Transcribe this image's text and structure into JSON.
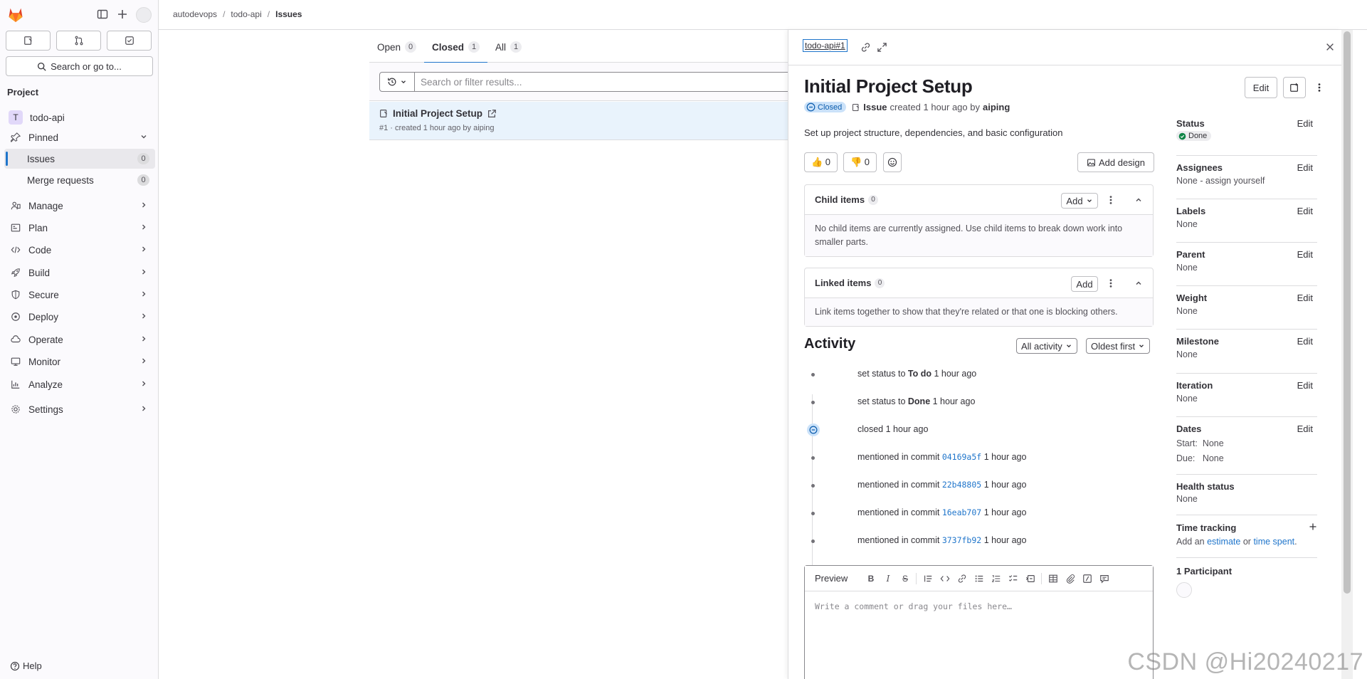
{
  "sidebar": {
    "search_label": "Search or go to...",
    "section_title": "Project",
    "project_name": "todo-api",
    "project_initial": "T",
    "pinned_label": "Pinned",
    "pinned_items": [
      {
        "label": "Issues",
        "count": "0"
      },
      {
        "label": "Merge requests",
        "count": "0"
      }
    ],
    "nav_items": [
      "Manage",
      "Plan",
      "Code",
      "Build",
      "Secure",
      "Deploy",
      "Operate",
      "Monitor",
      "Analyze",
      "Settings"
    ],
    "help_label": "Help"
  },
  "breadcrumbs": [
    "autodevops",
    "todo-api",
    "Issues"
  ],
  "tabs": [
    {
      "label": "Open",
      "count": "0"
    },
    {
      "label": "Closed",
      "count": "1"
    },
    {
      "label": "All",
      "count": "1"
    }
  ],
  "filter": {
    "placeholder": "Search or filter results..."
  },
  "issue_list": [
    {
      "title": "Initial Project Setup",
      "meta": "#1 · created 1 hour ago by aiping"
    }
  ],
  "drawer": {
    "reference": "todo-api#1",
    "title": "Initial Project Setup",
    "edit_label": "Edit",
    "state_badge": "Closed",
    "type_label": "Issue",
    "created_text": "created 1 hour ago by",
    "author": "aiping",
    "description": "Set up project structure, dependencies, and basic configuration",
    "thumbs_up": "👍 0",
    "thumbs_down": "👎 0",
    "add_design_label": "Add design",
    "child_items": {
      "title": "Child items",
      "count": "0",
      "add_label": "Add",
      "empty_text": "No child items are currently assigned. Use child items to break down work into smaller parts."
    },
    "linked_items": {
      "title": "Linked items",
      "count": "0",
      "add_label": "Add",
      "empty_text": "Link items together to show that they're related or that one is blocking others."
    },
    "activity": {
      "title": "Activity",
      "filter_label": "All activity",
      "sort_label": "Oldest first",
      "items": [
        {
          "prefix": "set status to",
          "bold": "To do",
          "suffix": "1 hour ago"
        },
        {
          "prefix": "set status to",
          "bold": "Done",
          "suffix": "1 hour ago"
        },
        {
          "prefix": "closed",
          "bold": "",
          "suffix": "1 hour ago"
        },
        {
          "prefix": "mentioned in commit",
          "commit": "04169a5f",
          "suffix": "1 hour ago"
        },
        {
          "prefix": "mentioned in commit",
          "commit": "22b48805",
          "suffix": "1 hour ago"
        },
        {
          "prefix": "mentioned in commit",
          "commit": "16eab707",
          "suffix": "1 hour ago"
        },
        {
          "prefix": "mentioned in commit",
          "commit": "3737fb92",
          "suffix": "1 hour ago"
        }
      ]
    },
    "editor": {
      "preview_label": "Preview",
      "placeholder": "Write a comment or drag your files here…"
    }
  },
  "widgets": {
    "edit_label": "Edit",
    "status": {
      "label": "Status",
      "value": "Done"
    },
    "assignees": {
      "label": "Assignees",
      "value": "None - assign yourself"
    },
    "labels": {
      "label": "Labels",
      "value": "None"
    },
    "parent": {
      "label": "Parent",
      "value": "None"
    },
    "weight": {
      "label": "Weight",
      "value": "None"
    },
    "milestone": {
      "label": "Milestone",
      "value": "None"
    },
    "iteration": {
      "label": "Iteration",
      "value": "None"
    },
    "dates": {
      "label": "Dates",
      "start": "Start:  None",
      "due": "Due:   None"
    },
    "health": {
      "label": "Health status",
      "value": "None"
    },
    "time_tracking": {
      "label": "Time tracking",
      "prefix": "Add an",
      "estimate": "estimate",
      "or": "or",
      "spent": "time spent",
      "end": "."
    },
    "participants": {
      "label": "1 Participant"
    }
  },
  "watermark": "CSDN @Hi20240217",
  "colors": {
    "accent": "#1f75cb",
    "closed_badge_bg": "#cbe2f9",
    "active_row_bg": "#e9f3fc",
    "done": "#108548"
  }
}
